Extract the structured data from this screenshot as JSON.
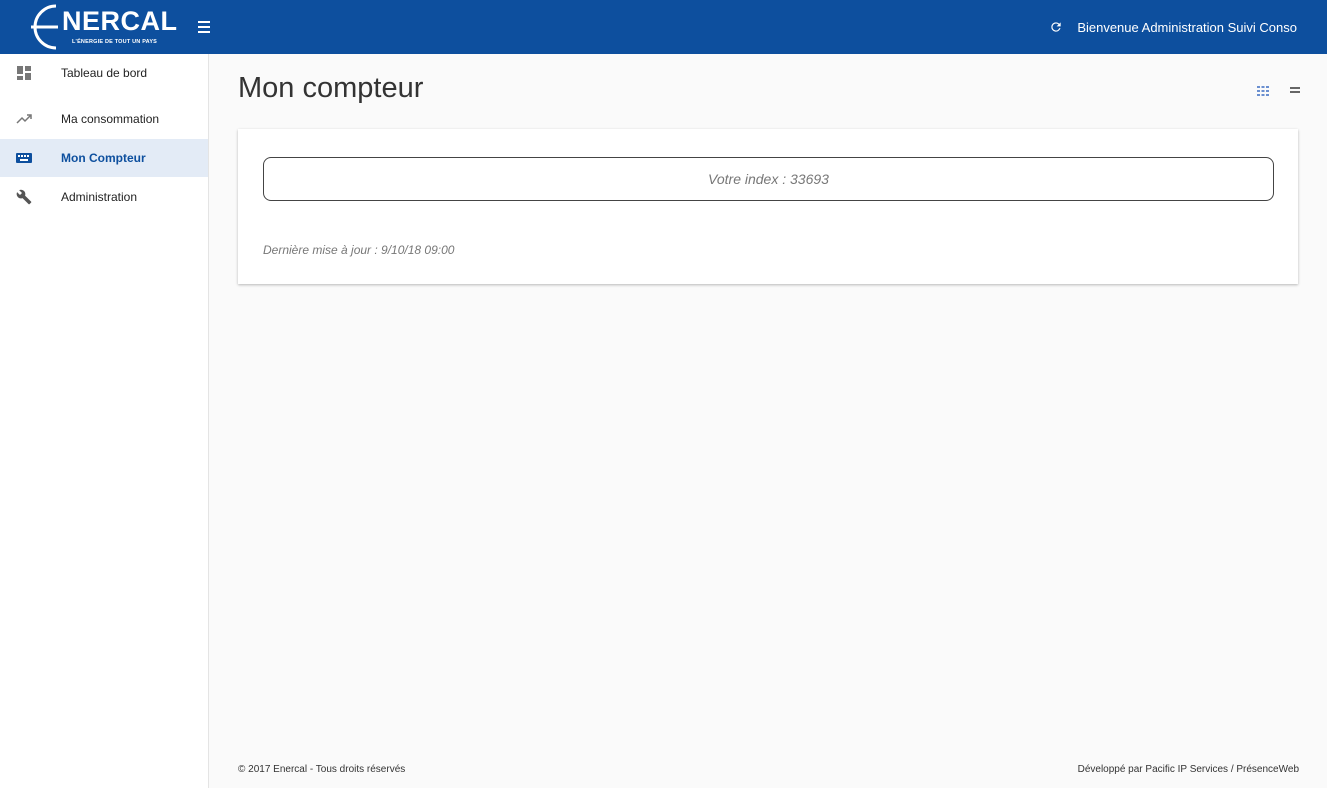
{
  "header": {
    "logo_text": "NERCAL",
    "logo_tagline": "L'ÉNERGIE DE TOUT UN PAYS",
    "welcome": "Bienvenue Administration Suivi Conso",
    "brand_color": "#0d4f9e"
  },
  "sidebar": {
    "items": [
      {
        "label": "Tableau de bord",
        "icon": "dashboard-icon",
        "active": false
      },
      {
        "label": "Ma consommation",
        "icon": "trending-up-icon",
        "active": false
      },
      {
        "label": "Mon Compteur",
        "icon": "keyboard-icon",
        "active": true
      },
      {
        "label": "Administration",
        "icon": "wrench-icon",
        "active": false
      }
    ]
  },
  "main": {
    "title": "Mon compteur",
    "index_text": "Votre index : 33693",
    "last_update": "Dernière mise à jour : 9/10/18 09:00"
  },
  "footer": {
    "copyright": "© 2017 Enercal - Tous droits réservés",
    "credits": "Développé par Pacific IP Services / PrésenceWeb"
  }
}
